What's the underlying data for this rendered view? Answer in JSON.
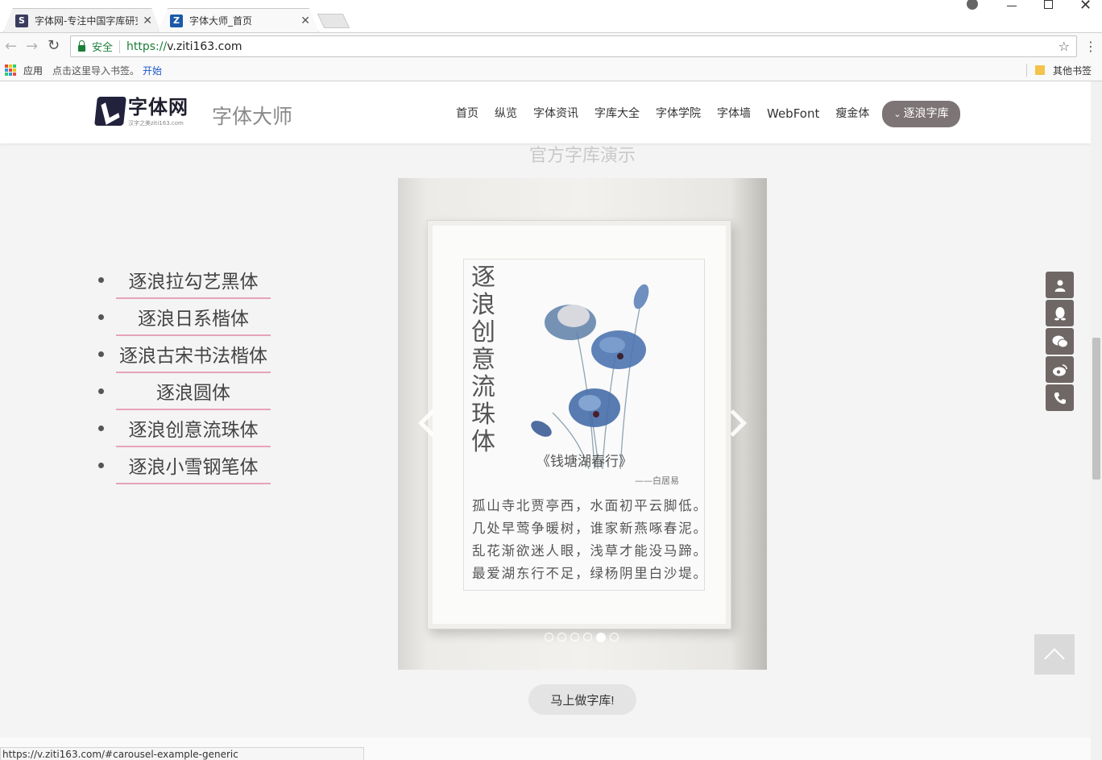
{
  "browser": {
    "tabs": [
      {
        "title": "字体网-专注中国字库研究",
        "icon": "ziti-logo-icon",
        "active": false
      },
      {
        "title": "字体大师_首页",
        "icon": "z-logo-icon",
        "active": true
      }
    ],
    "security_label": "安全",
    "url_scheme": "https://",
    "url_host": "v.ziti163.com",
    "bookmarks": {
      "apps_label": "应用",
      "import_hint": "点击这里导入书签。",
      "start_link": "开始",
      "other_label": "其他书签"
    },
    "status_url": "https://v.ziti163.com/#carousel-example-generic"
  },
  "header": {
    "logo_title": "字体网",
    "logo_subtitle": "汉字之美ziti163.com",
    "site_title": "字体大师",
    "nav": [
      "首页",
      "纵览",
      "字体资讯",
      "字库大全",
      "字体学院",
      "字体墙",
      "WebFont",
      "瘦金体"
    ],
    "nav_active": "逐浪字库"
  },
  "main": {
    "section_title": "官方字库演示",
    "font_list": [
      "逐浪拉勾艺黑体",
      "逐浪日系楷体",
      "逐浪古宋书法楷体",
      "逐浪圆体",
      "逐浪创意流珠体",
      "逐浪小雪钢笔体"
    ],
    "slide": {
      "vertical_title": "逐浪创意流珠体",
      "poem_title": "《钱塘湖春行》",
      "poem_author": "——白居易",
      "poem_lines": [
        "孤山寺北贾亭西，水面初平云脚低。",
        "几处早莺争暖树，谁家新燕啄春泥。",
        "乱花渐欲迷人眼，浅草才能没马蹄。",
        "最爱湖东行不足，绿杨阴里白沙堤。"
      ]
    },
    "carousel": {
      "slide_count": 6,
      "active_index": 4
    },
    "cta_label": "马上做字库!"
  },
  "side_tools": [
    "user-icon",
    "qq-icon",
    "wechat-icon",
    "weibo-icon",
    "phone-icon"
  ],
  "colors": {
    "accent_pink": "#e7a3bb",
    "nav_active_bg": "#7d7476",
    "tool_bg": "#6f6765",
    "secure_green": "#1a7f37",
    "link_blue": "#1a56c9"
  }
}
